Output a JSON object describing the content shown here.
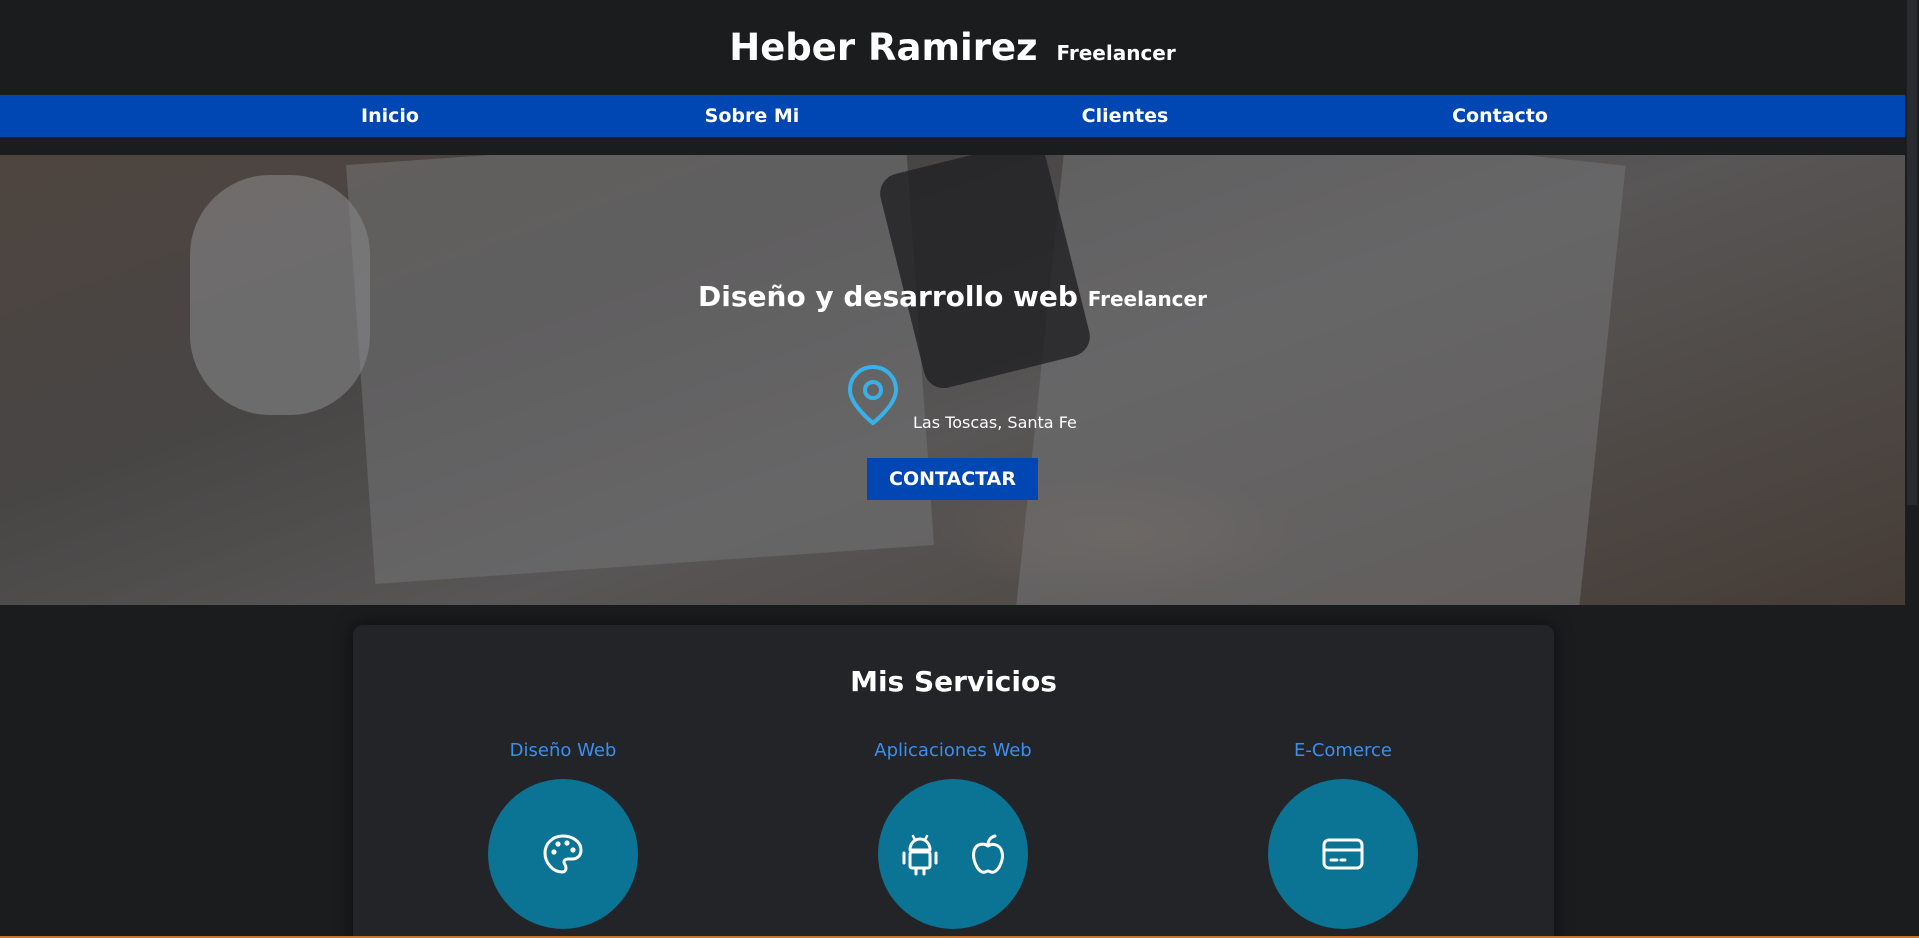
{
  "header": {
    "name": "Heber Ramirez",
    "tagline": "Freelancer"
  },
  "nav": {
    "items": [
      {
        "label": "Inicio"
      },
      {
        "label": "Sobre Mi"
      },
      {
        "label": "Clientes"
      },
      {
        "label": "Contacto"
      }
    ]
  },
  "hero": {
    "title": "Diseño y desarrollo web",
    "title_suffix": "Freelancer",
    "location": "Las Toscas, Santa Fe",
    "location_icon": "map-pin-icon",
    "cta_label": "CONTACTAR"
  },
  "services": {
    "title": "Mis Servicios",
    "items": [
      {
        "label": "Diseño Web",
        "icons": [
          "palette-icon"
        ]
      },
      {
        "label": "Aplicaciones Web",
        "icons": [
          "android-icon",
          "apple-icon"
        ]
      },
      {
        "label": "E-Comerce",
        "icons": [
          "credit-card-icon"
        ]
      }
    ]
  },
  "colors": {
    "accent": "#0047b3",
    "link": "#3a8ff0",
    "service_circle": "#0b7393",
    "background": "#1b1c1e",
    "pin": "#3ab0e8"
  }
}
